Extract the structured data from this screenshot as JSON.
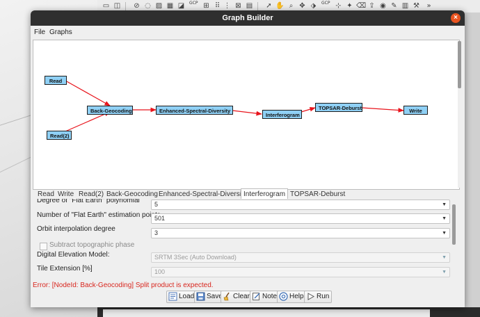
{
  "window": {
    "title": "Graph Builder",
    "close_glyph": "×"
  },
  "menu": {
    "file": "File",
    "graphs": "Graphs"
  },
  "background_toolbar": {
    "gcp_label_1": "GCP",
    "gcp_label_2": "GCP"
  },
  "graph": {
    "nodes": [
      {
        "id": "read",
        "label": "Read"
      },
      {
        "id": "read2",
        "label": "Read(2)"
      },
      {
        "id": "back-geocoding",
        "label": "Back-Geocoding"
      },
      {
        "id": "esd",
        "label": "Enhanced-Spectral-Diversity"
      },
      {
        "id": "interferogram",
        "label": "Interferogram"
      },
      {
        "id": "topsar-deburst",
        "label": "TOPSAR-Deburst"
      },
      {
        "id": "write",
        "label": "Write"
      }
    ],
    "edge_color": "#e8141c",
    "node_color": "#8fd0f5"
  },
  "tabs": [
    "Read",
    "Write",
    "Read(2)",
    "Back-Geocoding",
    "Enhanced-Spectral-Diversity",
    "Interferogram",
    "TOPSAR-Deburst"
  ],
  "active_tab": "Interferogram",
  "form": {
    "flat_earth_poly_label": "Degree of \"Flat Earth\" polynomial",
    "flat_earth_poly_value": "5",
    "flat_earth_points_label": "Number of \"Flat Earth\" estimation points",
    "flat_earth_points_value": "501",
    "orbit_degree_label": "Orbit interpolation degree",
    "orbit_degree_value": "3",
    "subtract_topo_label": "Subtract topographic phase",
    "dem_label": "Digital Elevation Model:",
    "dem_value": "SRTM 3Sec (Auto Download)",
    "tile_ext_label": "Tile Extension [%]",
    "tile_ext_value": "100"
  },
  "error_message": "Error: [NodeId: Back-Geocoding] Split product is expected.",
  "error_color": "#d8261e",
  "buttons": {
    "load": "Load",
    "save": "Save",
    "clear": "Clear",
    "note": "Note",
    "help": "Help",
    "run": "Run"
  },
  "accent_close": "#e95420"
}
